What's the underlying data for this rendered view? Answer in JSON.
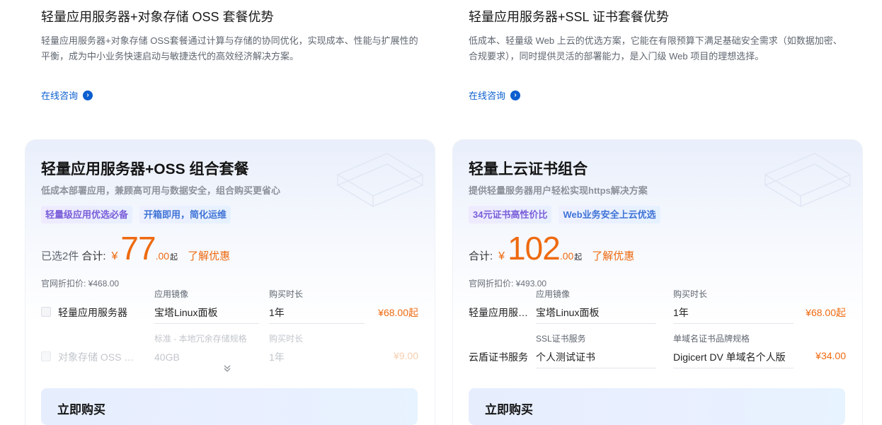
{
  "left": {
    "intro": {
      "title": "轻量应用服务器+对象存储 OSS 套餐优势",
      "desc": "轻量应用服务器+对象存储 OSS套餐通过计算与存储的协同优化，实现成本、性能与扩展性的平衡，成为中小业务快速启动与敏捷迭代的高效经济解决方案。",
      "consult": "在线咨询"
    },
    "card": {
      "title": "轻量应用服务器+OSS 组合套餐",
      "subtitle": "低成本部署应用，兼顾高可用与数据安全，组合购买更省心",
      "tags": [
        "轻量级应用优选必备",
        "开箱即用，简化运维"
      ],
      "selected": "已选2件",
      "total_label": "合计:",
      "yen": "¥",
      "price_int": "77",
      "price_dec": ".00",
      "qi": "起",
      "discount_link": "了解优惠",
      "list_price": "官网折扣价: ¥468.00",
      "items": [
        {
          "name": "轻量应用服务器",
          "f1_label": "应用镜像",
          "f1_value": "宝塔Linux面板",
          "f2_label": "购买时长",
          "f2_value": "1年",
          "price": "¥68.00起"
        },
        {
          "name": "对象存储 OSS 资源包",
          "f1_label": "标准 - 本地冗余存储规格",
          "f1_value": "40GB",
          "f2_label": "购买时长",
          "f2_value": "1年",
          "price": "¥9.00"
        }
      ],
      "expand": "⌄",
      "buy": "立即购买"
    }
  },
  "right": {
    "intro": {
      "title": "轻量应用服务器+SSL 证书套餐优势",
      "desc": "低成本、轻量级 Web 上云的优选方案，它能在有限预算下满足基础安全需求（如数据加密、合规要求），同时提供灵活的部署能力，是入门级 Web 项目的理想选择。",
      "consult": "在线咨询"
    },
    "card": {
      "title": "轻量上云证书组合",
      "subtitle": "提供轻量服务器用户轻松实现https解决方案",
      "tags": [
        "34元证书高性价比",
        "Web业务安全上云优选"
      ],
      "total_label": "合计:",
      "yen": "¥",
      "price_int": "102",
      "price_dec": ".00",
      "qi": "起",
      "discount_link": "了解优惠",
      "list_price": "官网折扣价: ¥493.00",
      "items": [
        {
          "name": "轻量应用服务器",
          "f1_label": "应用镜像",
          "f1_value": "宝塔Linux面板",
          "f2_label": "购买时长",
          "f2_value": "1年",
          "price": "¥68.00起"
        },
        {
          "name": "云盾证书服务",
          "f1_label": "SSL证书服务",
          "f1_value": "个人测试证书",
          "f2_label": "单域名证书品牌规格",
          "f2_value": "Digicert DV 单域名个人版",
          "price": "¥34.00"
        }
      ],
      "buy": "立即购买"
    }
  },
  "colors": {
    "accent_orange": "#ee6a10",
    "link_blue": "#0c5fcf",
    "tag_purple": "#7a5ed9",
    "tag_blue": "#3f73d6"
  },
  "icons": {
    "consult": "chevron-right-circle-icon",
    "expand": "chevron-double-down-icon"
  }
}
